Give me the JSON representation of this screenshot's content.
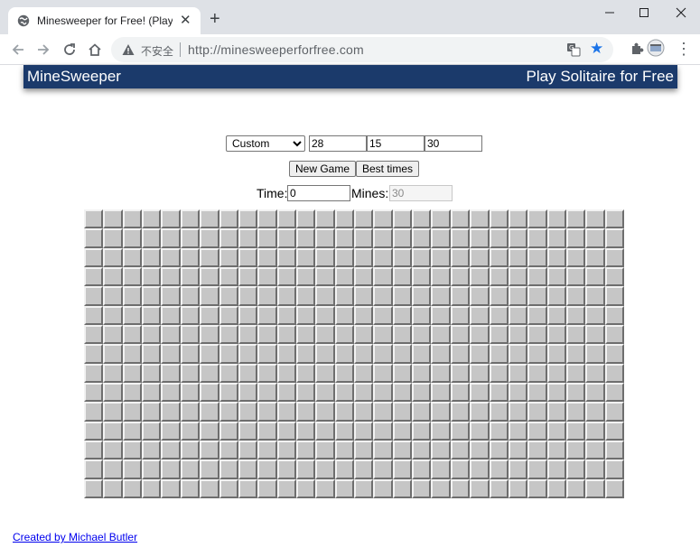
{
  "browser": {
    "tab_title": "Minesweeper for Free! (Play In",
    "security_label": "不安全",
    "url": "http://minesweeperforfree.com",
    "icons": {
      "tab": "globe-icon",
      "close": "close-icon",
      "new_tab": "plus-icon",
      "back": "back-arrow-icon",
      "forward": "forward-arrow-icon",
      "reload": "reload-icon",
      "home": "home-icon",
      "security": "warning-icon",
      "translate": "translate-icon",
      "bookmark": "star-icon",
      "extensions": "puzzle-icon",
      "profile": "profile-icon",
      "menu": "kebab-menu-icon"
    },
    "accent_color": "#1a73e8"
  },
  "header": {
    "title": "MineSweeper",
    "link": "Play Solitaire for Free",
    "background": "#1b3a6b"
  },
  "controls": {
    "level_selected": "Custom",
    "columns": "28",
    "rows": "15",
    "mines": "30",
    "new_game_label": "New Game",
    "best_times_label": "Best times",
    "time_label": "Time:",
    "time_value": "0",
    "mines_label": "Mines:",
    "mines_value": "30"
  },
  "board": {
    "columns": 28,
    "rows": 15,
    "state": "all-unrevealed"
  },
  "footer": {
    "credit": "Created by Michael Butler"
  }
}
